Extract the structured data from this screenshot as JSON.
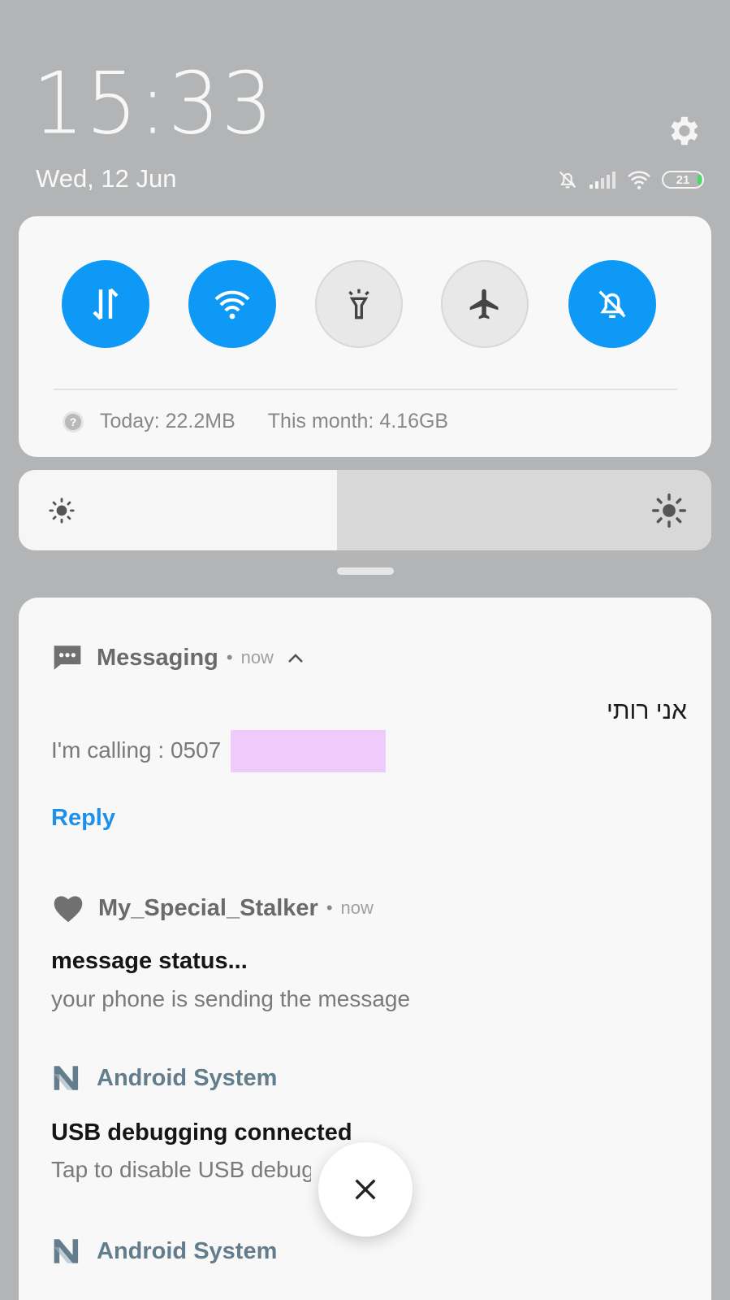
{
  "lockscreen": {
    "clock": "15:33",
    "date": "Wed, 12 Jun",
    "battery_level": "21"
  },
  "status_icons": [
    "mute-icon",
    "signal-icon",
    "wifi-icon",
    "battery-icon"
  ],
  "quick_toggles": [
    {
      "name": "mobile-data",
      "icon": "data-arrows-icon",
      "state": "on"
    },
    {
      "name": "wifi",
      "icon": "wifi-icon",
      "state": "on"
    },
    {
      "name": "flashlight",
      "icon": "flashlight-icon",
      "state": "off"
    },
    {
      "name": "airplane-mode",
      "icon": "airplane-icon",
      "state": "off"
    },
    {
      "name": "silent",
      "icon": "bell-off-icon",
      "state": "on"
    }
  ],
  "data_usage": {
    "today": "Today: 22.2MB",
    "month": "This month: 4.16GB"
  },
  "brightness": {
    "level_fraction": 0.46
  },
  "notifications": {
    "messaging": {
      "app": "Messaging",
      "time": "now",
      "sender": "אני רותי",
      "text": "I'm calling :  0507",
      "reply": "Reply"
    },
    "stalker": {
      "app": "My_Special_Stalker",
      "time": "now",
      "title": "message status...",
      "text": "your phone is sending the message"
    },
    "android1": {
      "app": "Android System",
      "title": "USB debugging connected",
      "text": "Tap to disable USB debugging"
    },
    "android2": {
      "app": "Android System"
    }
  },
  "colors": {
    "accent": "#0d99f5",
    "reply": "#1e90ea",
    "redaction": "#efcbfc"
  }
}
